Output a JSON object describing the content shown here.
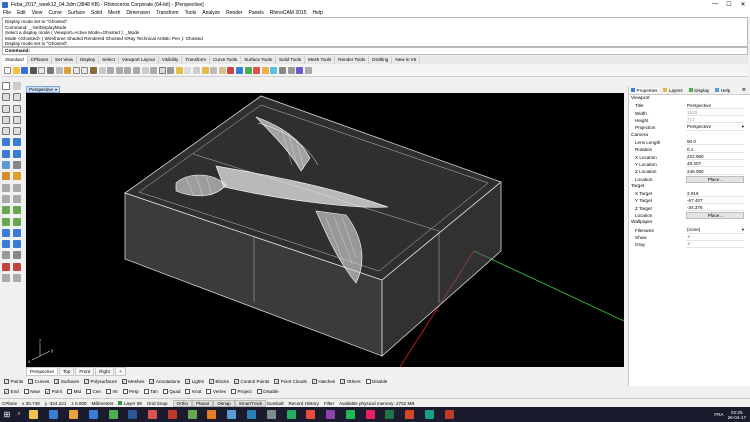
{
  "window": {
    "title": "Feba_2017_week12_04.3dm (3848 KB) - Rhinoceros Corporate (64-bit) - [Perspective]",
    "controls": [
      "—",
      "☐",
      "✕"
    ]
  },
  "menu": [
    "File",
    "Edit",
    "View",
    "Curve",
    "Surface",
    "Solid",
    "Mesh",
    "Dimension",
    "Transform",
    "Tools",
    "Analyze",
    "Render",
    "Panels",
    "RhinoCAM 2015",
    "Help"
  ],
  "command_history": [
    "Display mode set to \"Ghosted\".",
    "Command: _-SetDisplayMode",
    "Select a display mode ( Viewport=Active  Mode=Ghosted ): _Mode",
    "Mode <Ghosted> ( Wireframe  Shaded  Rendered  Ghosted  XRay  Technical  Artistic  Pen ): Ghosted",
    "Display mode set to \"Ghosted\"."
  ],
  "command_prompt": "Command:",
  "toolbar_tabs": [
    "Standard",
    "CPlanes",
    "Set View",
    "Display",
    "Select",
    "Viewport Layout",
    "Visibility",
    "Transform",
    "Curve Tools",
    "Surface Tools",
    "Solid Tools",
    "Mesh Tools",
    "Render Tools",
    "Drafting",
    "New in V5"
  ],
  "toolbar_active": "Standard",
  "viewport": {
    "active_label": "Perspective",
    "dropdown_icon": "chevron-down-icon",
    "axis_labels": {
      "x": "x",
      "y": "y",
      "z": "z"
    }
  },
  "viewport_tabs": [
    "Perspective",
    "Top",
    "Front",
    "Right",
    "+"
  ],
  "viewport_tab_active": "Perspective",
  "snaps_row1": [
    {
      "label": "Points",
      "checked": true
    },
    {
      "label": "Curves",
      "checked": true
    },
    {
      "label": "Surfaces",
      "checked": true
    },
    {
      "label": "Polysurfaces",
      "checked": true
    },
    {
      "label": "Meshes",
      "checked": true
    },
    {
      "label": "Annotations",
      "checked": true
    },
    {
      "label": "Lights",
      "checked": true
    },
    {
      "label": "Blocks",
      "checked": true
    },
    {
      "label": "Control Points",
      "checked": true
    },
    {
      "label": "Point Clouds",
      "checked": true
    },
    {
      "label": "Hatches",
      "checked": true
    },
    {
      "label": "Others",
      "checked": true
    },
    {
      "label": "Disable",
      "checked": false
    }
  ],
  "snaps_row2": [
    {
      "label": "End",
      "checked": true
    },
    {
      "label": "Near",
      "checked": false
    },
    {
      "label": "Point",
      "checked": true
    },
    {
      "label": "Mid",
      "checked": false
    },
    {
      "label": "Cen",
      "checked": false
    },
    {
      "label": "Int",
      "checked": false
    },
    {
      "label": "Perp",
      "checked": false
    },
    {
      "label": "Tan",
      "checked": false
    },
    {
      "label": "Quad",
      "checked": false
    },
    {
      "label": "Knot",
      "checked": false
    },
    {
      "label": "Vertex",
      "checked": false
    },
    {
      "label": "Project",
      "checked": false
    },
    {
      "label": "Disable",
      "checked": false
    }
  ],
  "status": {
    "cplane": "CPlane",
    "x": "x 30.749",
    "y": "y -324.221",
    "z": "z 0.000",
    "units": "Millimeters",
    "layer": "Layer 08",
    "toggles": [
      "Grid Snap",
      "Ortho",
      "Planar",
      "Osnap",
      "SmartTrack",
      "Gumball",
      "Record History",
      "Filter"
    ],
    "memory": "Available physical memory: 2752 MB"
  },
  "panel": {
    "tabs": [
      "Properties",
      "Layers",
      "Display",
      "Help"
    ],
    "active_tab": "Properties",
    "sections": [
      {
        "title": "Viewport",
        "rows": [
          {
            "k": "Title",
            "v": "Perspective"
          },
          {
            "k": "Width",
            "v": "1533",
            "dim": true
          },
          {
            "k": "Height",
            "v": "717",
            "dim": true
          },
          {
            "k": "Projection",
            "v": "Perspective",
            "select": true
          }
        ]
      },
      {
        "title": "Camera",
        "rows": [
          {
            "k": "Lens Length",
            "v": "50.0"
          },
          {
            "k": "Rotation",
            "v": "0.1"
          },
          {
            "k": "X Location",
            "v": "222.950"
          },
          {
            "k": "Y Location",
            "v": "48.307"
          },
          {
            "k": "Z Location",
            "v": "246.060"
          },
          {
            "k": "Location",
            "v": "Place...",
            "btn": true
          }
        ]
      },
      {
        "title": "Target",
        "rows": [
          {
            "k": "X Target",
            "v": "2.916"
          },
          {
            "k": "Y Target",
            "v": "-67.407"
          },
          {
            "k": "Z Target",
            "v": "-34.376"
          },
          {
            "k": "Location",
            "v": "Place...",
            "btn": true
          }
        ]
      },
      {
        "title": "Wallpaper",
        "rows": [
          {
            "k": "Filename",
            "v": "(none)",
            "select": true
          },
          {
            "k": "Show",
            "v": "✓"
          },
          {
            "k": "Gray",
            "v": "✓"
          }
        ]
      }
    ]
  },
  "taskbar": {
    "start_icon": "windows-logo-icon",
    "search_icon": "search-icon",
    "apps": [
      "file-explorer-icon",
      "store-icon",
      "folder-icon",
      "store-2-icon",
      "chrome-icon",
      "word-icon",
      "acrobat-icon",
      "media-icon",
      "photos-icon",
      "paint-icon",
      "rhino-icon",
      "mail-icon",
      "settings-icon",
      "xbox-icon",
      "calendar-icon",
      "onenote-icon",
      "spotify-icon",
      "music-icon",
      "excel-icon",
      "powerpoint-icon",
      "maps-icon",
      "video-icon"
    ],
    "lang": "FRA",
    "time": "02:25",
    "date": "26-04-17"
  },
  "colors": {
    "viewport_bg": "#000000",
    "model_edges": "#d8d8d8",
    "x_axis": "#cc1e1e",
    "y_axis": "#2fbf3a",
    "panel_accent": "#3a7bd5"
  }
}
